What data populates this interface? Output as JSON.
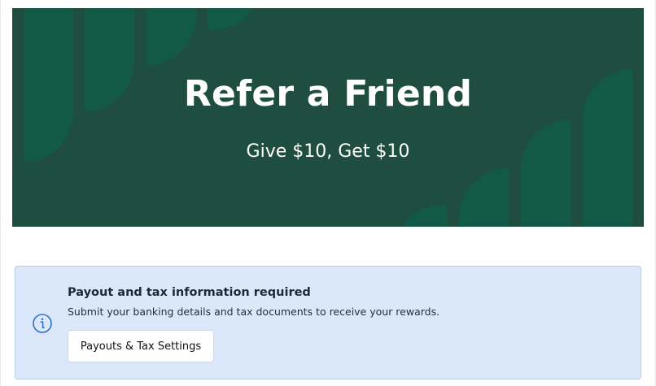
{
  "hero": {
    "title": "Refer a Friend",
    "subtitle": "Give $10, Get $10",
    "background_color": "#1f4d3f",
    "shape_color": "#125a46"
  },
  "notice": {
    "icon": "info-icon",
    "title": "Payout and tax information required",
    "description": "Submit your banking details and tax documents to receive your rewards.",
    "button_label": "Payouts & Tax Settings",
    "background_color": "#dbe8fb",
    "border_color": "#b9cfee",
    "icon_color": "#2d6fcf"
  }
}
